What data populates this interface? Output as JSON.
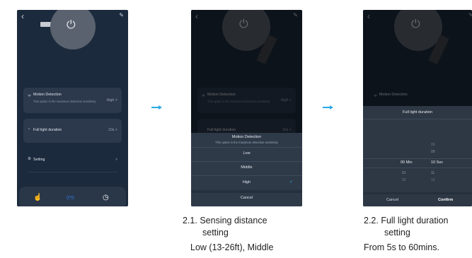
{
  "app_title": "CW_PIR_Light",
  "icons": {
    "back": "back-icon",
    "edit": "edit-icon",
    "power": "power-icon",
    "motion": "motion-icon",
    "timer": "timer-icon",
    "gear": "gear-icon",
    "hand": "hand-icon",
    "radar": "radar-icon",
    "clock": "clock-icon",
    "check": "check-icon"
  },
  "screen1": {
    "motion_title": "Motion Detection",
    "motion_desc": "This option is the maximum detection sensitivity",
    "motion_value": "High",
    "duration_title": "Full light duration",
    "duration_value": "10s",
    "setting_title": "Setting",
    "chevron": ">"
  },
  "screen2": {
    "sheet_title": "Motion Detection",
    "sheet_subtitle": "This option is the maximum detection sensitivity",
    "options": [
      "Low",
      "Middle",
      "High"
    ],
    "selected": "High",
    "cancel": "Cancel",
    "check": "✓"
  },
  "screen3": {
    "sheet_title": "Full light duration",
    "minutes_col": [
      "00 Min",
      "01",
      "02"
    ],
    "seconds_col": [
      "09",
      "10 Sec",
      "11",
      "12"
    ],
    "seconds_above": "09",
    "cancel": "Cancel",
    "confirm": "Confirm"
  },
  "captions": {
    "c2_line1": "2.1. Sensing distance",
    "c2_line2": "setting",
    "c2_line3": "Low (13-26ft), Middle",
    "c3_line1": "2.2. Full light duration",
    "c3_line2": "setting",
    "c3_line3": "From 5s to 60mins."
  },
  "colors": {
    "accent": "#29a9e6",
    "background": "#1c2a3d",
    "card": "#2c394c"
  }
}
